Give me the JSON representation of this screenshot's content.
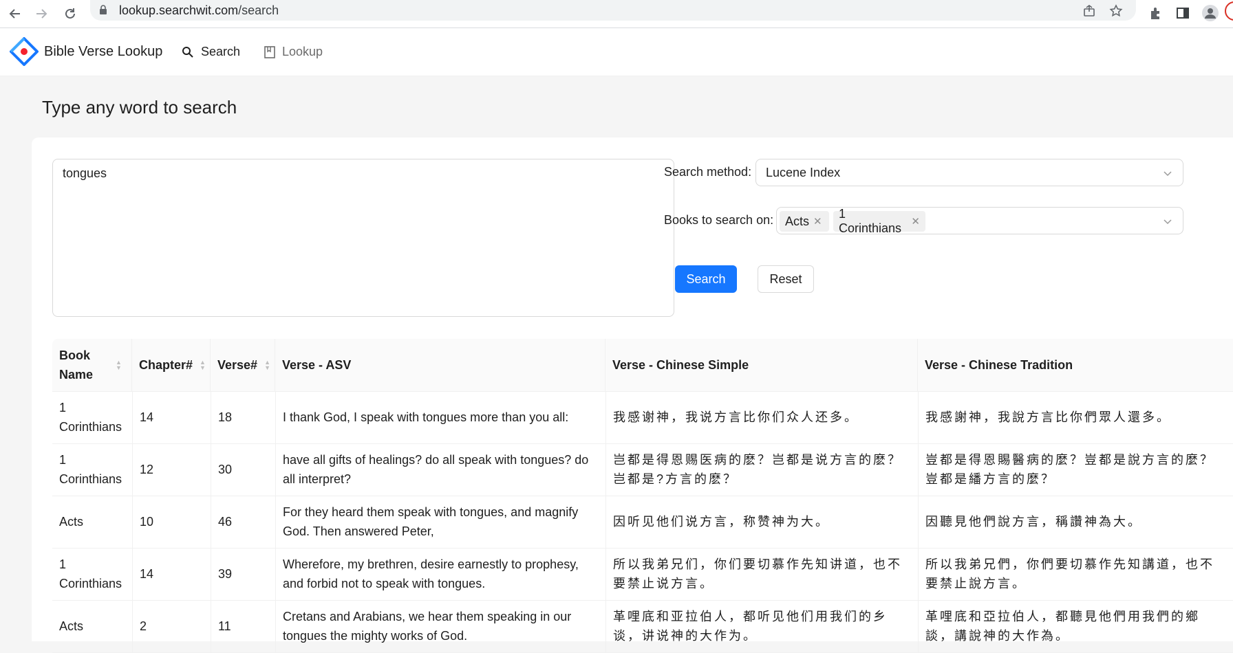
{
  "browser": {
    "url_host": "lookup.searchwit.com",
    "url_path": "/search"
  },
  "app": {
    "title": "Bible Verse Lookup",
    "menu": [
      {
        "label": "Search",
        "icon": "search-icon"
      },
      {
        "label": "Lookup",
        "icon": "book-icon"
      }
    ]
  },
  "page": {
    "heading": "Type any word to search"
  },
  "search_form": {
    "query": "tongues",
    "method_label": "Search method",
    "method_value": "Lucene Index",
    "books_label": "Books to search on",
    "books_selected": [
      "Acts",
      "1 Corinthians"
    ],
    "search_button": "Search",
    "reset_button": "Reset"
  },
  "colors": {
    "primary": "#1677ff",
    "header_bg": "#fafafa",
    "border": "#f0f0f0"
  },
  "results": {
    "columns": [
      "Book Name",
      "Chapter#",
      "Verse#",
      "Verse - ASV",
      "Verse - Chinese Simple",
      "Verse - Chinese Tradition"
    ],
    "rows": [
      {
        "book": "1 Corinthians",
        "chapter": "14",
        "verse": "18",
        "asv": "I thank God, I speak with tongues more than you all:",
        "zh_simple": "我感谢神，我说方言比你们众人还多。",
        "zh_trad": "我感謝神，我說方言比你們眾人還多。"
      },
      {
        "book": "1 Corinthians",
        "chapter": "12",
        "verse": "30",
        "asv": "have all gifts of healings? do all speak with tongues? do all interpret?",
        "zh_simple": "岂都是得恩赐医病的麽？岂都是说方言的麽？岂都是?方言的麽？",
        "zh_trad": "豈都是得恩賜醫病的麼？豈都是說方言的麼？豈都是繙方言的麼？"
      },
      {
        "book": "Acts",
        "chapter": "10",
        "verse": "46",
        "asv": "For they heard them speak with tongues, and magnify God. Then answered Peter,",
        "zh_simple": "因听见他们说方言，称赞神为大。",
        "zh_trad": "因聽見他們說方言，稱讚神為大。"
      },
      {
        "book": "1 Corinthians",
        "chapter": "14",
        "verse": "39",
        "asv": "Wherefore, my brethren, desire earnestly to prophesy, and forbid not to speak with tongues.",
        "zh_simple": "所以我弟兄们，你们要切慕作先知讲道，也不要禁止说方言。",
        "zh_trad": "所以我弟兄們，你們要切慕作先知講道，也不要禁止說方言。"
      },
      {
        "book": "Acts",
        "chapter": "2",
        "verse": "11",
        "asv": "Cretans and Arabians, we hear them speaking in our tongues the mighty works of God.",
        "zh_simple": "革哩底和亚拉伯人，都听见他们用我们的乡谈，讲说神的大作为。",
        "zh_trad": "革哩底和亞拉伯人，都聽見他們用我們的鄉談，講說神的大作為。"
      }
    ]
  }
}
